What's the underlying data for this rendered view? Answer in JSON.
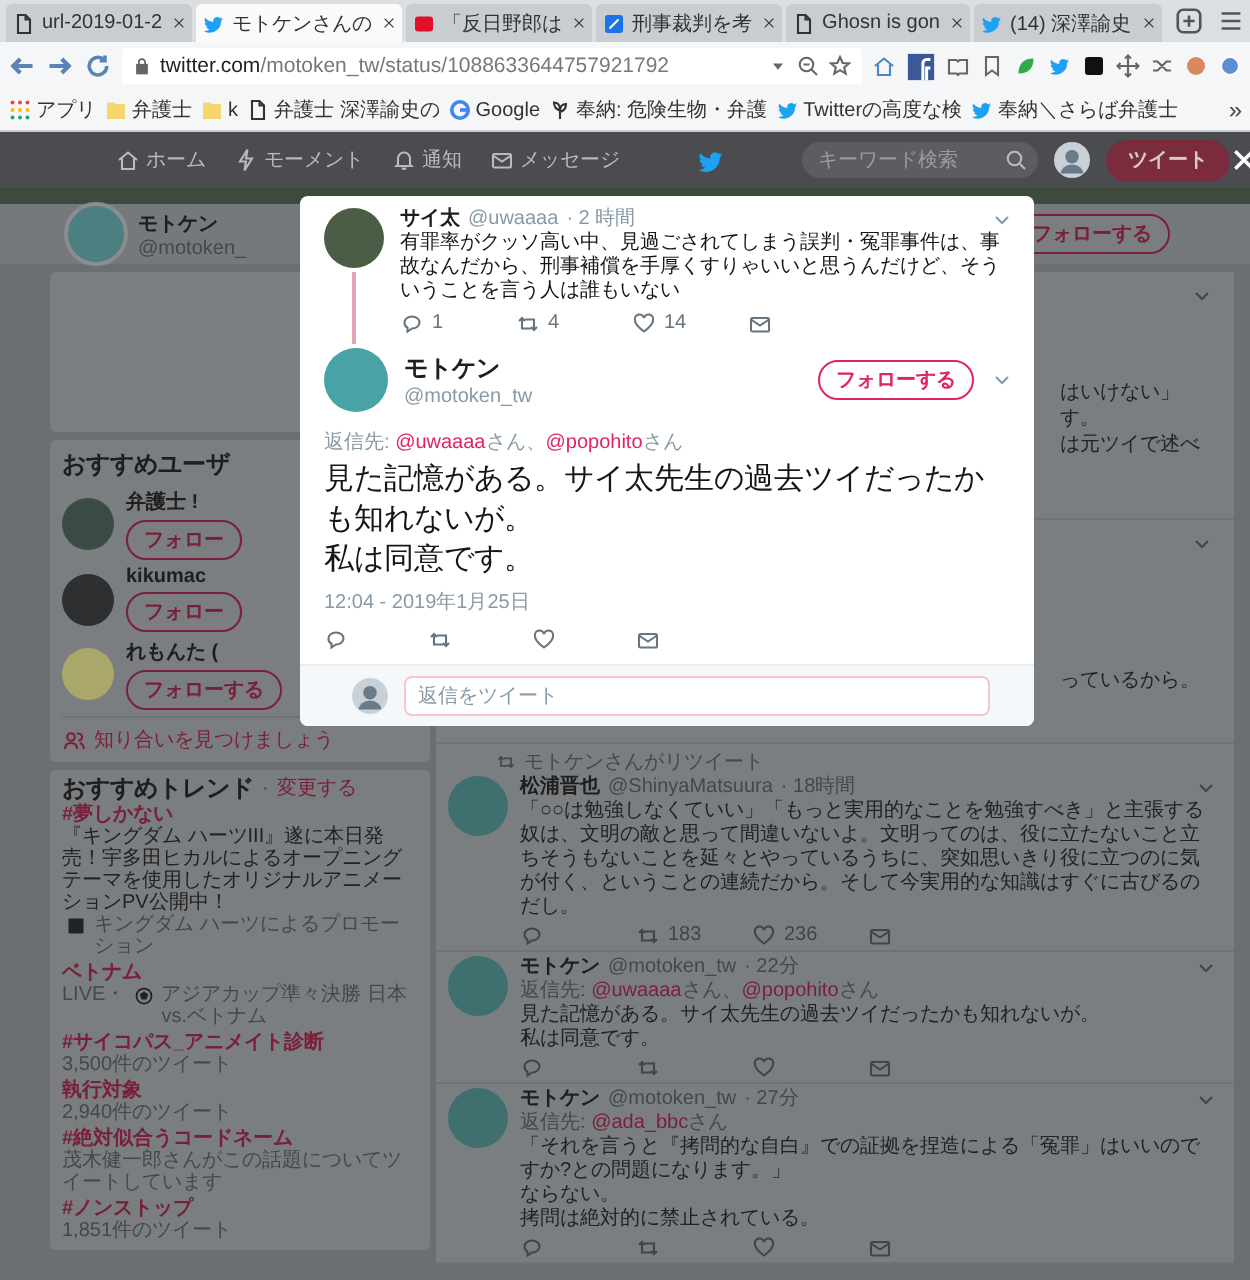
{
  "browser": {
    "tabs": [
      {
        "title": "url-2019-01-2",
        "kind": "page",
        "selected": false
      },
      {
        "title": "モトケンさんの",
        "kind": "bird",
        "selected": true
      },
      {
        "title": "「反日野郎は",
        "kind": "yahoo",
        "selected": false
      },
      {
        "title": "刑事裁判を考",
        "kind": "pen",
        "selected": false
      },
      {
        "title": "Ghosn is gon",
        "kind": "page",
        "selected": false
      },
      {
        "title": "(14) 深澤諭史",
        "kind": "bird",
        "selected": false
      }
    ],
    "address": {
      "host": "twitter.com",
      "path": "/motoken_tw/status/1088633644757921792"
    },
    "bookmarks": [
      {
        "label": "アプリ",
        "kind": "apps"
      },
      {
        "label": "弁護士",
        "kind": "folder"
      },
      {
        "label": "k",
        "kind": "folder"
      },
      {
        "label": "弁護士 深澤諭史の",
        "kind": "page"
      },
      {
        "label": "Google",
        "kind": "google"
      },
      {
        "label": "奉納: 危険生物・弁護",
        "kind": "plant"
      },
      {
        "label": "Twitterの高度な検",
        "kind": "bird"
      },
      {
        "label": "奉納＼さらば弁護士",
        "kind": "bird"
      }
    ],
    "more": "»"
  },
  "nav": {
    "items": [
      {
        "label": "ホーム",
        "kind": "home"
      },
      {
        "label": "モーメント",
        "kind": "bolt"
      },
      {
        "label": "通知",
        "kind": "bell"
      },
      {
        "label": "メッセージ",
        "kind": "mail"
      }
    ],
    "search": {
      "placeholder": "キーワード検索"
    },
    "tweet_button": "ツイート"
  },
  "profile": {
    "name": "モトケン",
    "handle": "@motoken_",
    "follow": "フォローする"
  },
  "suggested_users": {
    "title": "おすすめユーザ",
    "users": [
      {
        "name": "弁護士 !",
        "follow": "フォロー"
      },
      {
        "name": "kikumac",
        "follow": "フォロー"
      },
      {
        "name": "れもんた (",
        "follow": "フォローする"
      }
    ],
    "find_friends": "知り合いを見つけましょう"
  },
  "trends": {
    "title": "おすすめトレンド",
    "separator": "·",
    "change": "変更する",
    "items": [
      {
        "name": "#夢しかない",
        "desc": "『キングダム ハーツIII』遂に本日発売！宇多田ヒカルによるオープニングテーマを使用したオリジナルアニメーションPV公開中！",
        "promo": "キングダム ハーツによるプロモーション"
      },
      {
        "name": "ベトナム",
        "live": "LIVE・",
        "desc": "アジアカップ準々決勝 日本vs.ベトナム"
      },
      {
        "name": "#サイコパス_アニメイト診断",
        "desc": "3,500件のツイート"
      },
      {
        "name": "執行対象",
        "desc": "2,940件のツイート"
      },
      {
        "name": "#絶対似合うコードネーム",
        "desc": "茂木健一郎さんがこの話題についてツイートしています"
      },
      {
        "name": "#ノンストップ",
        "desc": "1,851件のツイート"
      }
    ]
  },
  "timeline": {
    "partial_tweets": [
      {
        "lines": [
          "はいけない」",
          "す。",
          "は元ツイで述べ"
        ]
      },
      {
        "lines": [
          "っているから。"
        ]
      }
    ],
    "tweets": [
      {
        "retweeted_by": "モトケンさんがリツイート",
        "name": "松浦晋也",
        "handle": "@ShinyaMatsuura",
        "time": "· 18時間",
        "lines": [
          "「○○は勉強しなくていい」「もっと実用的なことを勉強すべき」と主張する奴は、文明の敵と思って間違いないよ。文明ってのは、役に立たないこと立ちそうもないことを延々とやっているうちに、突如思いきり役に立つのに気が付く、ということの連続だから。そして今実用的な知識はすぐに古びるのだし。"
        ],
        "retweets": "183",
        "likes": "236"
      },
      {
        "name": "モトケン",
        "handle": "@motoken_tw",
        "time": "· 22分",
        "reply_to": {
          "label": "返信先:",
          "mentions": [
            {
              "handle": "@uwaaaa",
              "after": "さん、"
            },
            {
              "handle": "@popohito",
              "after": "さん"
            }
          ]
        },
        "lines": [
          "見た記憶がある。サイ太先生の過去ツイだったかも知れないが。",
          "私は同意です。"
        ]
      },
      {
        "name": "モトケン",
        "handle": "@motoken_tw",
        "time": "· 27分",
        "reply_to": {
          "label": "返信先:",
          "mentions": [
            {
              "handle": "@ada_bbc",
              "after": "さん"
            }
          ]
        },
        "lines": [
          "「それを言うと『拷問的な自白』での証拠を捏造による「冤罪」はいいのですか?との問題になります。」",
          "ならない。",
          "拷問は絶対的に禁止されている。"
        ]
      }
    ]
  },
  "modal": {
    "parent": {
      "name": "サイ太",
      "handle": "@uwaaaa",
      "time": "· 2 時間",
      "text": "有罪率がクッソ高い中、見過ごされてしまう誤判・冤罪事件は、事故なんだから、刑事補償を手厚くすりゃいいと思うんだけど、そういうことを言う人は誰もいない",
      "replies": "1",
      "retweets": "4",
      "likes": "14"
    },
    "tweet": {
      "name": "モトケン",
      "handle": "@motoken_tw",
      "follow": "フォローする",
      "reply_to": {
        "label": "返信先:",
        "mentions": [
          {
            "handle": "@uwaaaa",
            "after": "さん、"
          },
          {
            "handle": "@popohito",
            "after": "さん"
          }
        ]
      },
      "lines": [
        "見た記憶がある。サイ太先生の過去ツイだったかも知れないが。",
        "私は同意です。"
      ],
      "timestamp": "12:04 - 2019年1月25日"
    },
    "reply_box": {
      "placeholder": "返信をツイート"
    }
  }
}
